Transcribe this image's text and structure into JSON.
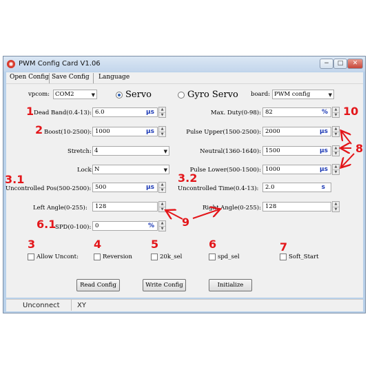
{
  "window": {
    "title": "PWM Config Card V1.06",
    "minimize": "−",
    "maximize": "□",
    "close": "✕",
    "icon": "app-logo-icon"
  },
  "menu": [
    "Open Config",
    "Save Config",
    "Language"
  ],
  "top": {
    "vpcom_label": "vpcom:",
    "vpcom_value": "COM2",
    "mode_servo": "Servo",
    "mode_gyro": "Gyro Servo",
    "mode_selected": "Servo",
    "board_label": "board:",
    "board_value": "PWM config"
  },
  "left": {
    "dead_band": {
      "label": "Dead Band(0.4-13):",
      "value": "6.0",
      "unit": "μs"
    },
    "boost": {
      "label": "Boost(10-2500):",
      "value": "1000",
      "unit": "μs"
    },
    "stretch": {
      "label": "Stretch:",
      "value": "4"
    },
    "lock": {
      "label": "Lock:",
      "value": "N"
    },
    "uncontrolled_pos": {
      "label": "Uncontrolled Pos(500-2500):",
      "value": "500",
      "unit": "μs"
    },
    "left_angle": {
      "label": "Left Angle(0-255):",
      "value": "128"
    },
    "spd": {
      "label": "SPD(0-100):",
      "value": "0",
      "unit": "%"
    }
  },
  "right": {
    "max_duty": {
      "label": "Max. Duty(0-98):",
      "value": "82",
      "unit": "%"
    },
    "pulse_upper": {
      "label": "Pulse Upper(1500-2500):",
      "value": "2000",
      "unit": "μs"
    },
    "neutral": {
      "label": "Neutral(1360-1640):",
      "value": "1500",
      "unit": "μs"
    },
    "pulse_lower": {
      "label": "Pulse Lower(500-1500):",
      "value": "1000",
      "unit": "μs"
    },
    "uncontrolled_time": {
      "label": "Uncontrolled Time(0.4-13):",
      "value": "2.0",
      "unit": "s"
    },
    "right_angle": {
      "label": "Right Angle(0-255):",
      "value": "128"
    }
  },
  "checkboxes": [
    {
      "label": "Allow Uncont:",
      "checked": false
    },
    {
      "label": "Reversion",
      "checked": false
    },
    {
      "label": "20k_sel",
      "checked": false
    },
    {
      "label": "spd_sel",
      "checked": false
    },
    {
      "label": "Soft_Start",
      "checked": false
    }
  ],
  "buttons": {
    "read": "Read Config",
    "write": "Write Config",
    "init": "Initialize"
  },
  "status": {
    "connection": "Unconnect",
    "extra": "XY"
  },
  "annotations": [
    "1",
    "2",
    "3.1",
    "6.1",
    "3",
    "4",
    "5",
    "6",
    "7",
    "10",
    "8",
    "3.2",
    "9"
  ],
  "colors": {
    "annotation": "#e3161a",
    "unit": "#1c39b5",
    "window_border": "#b9d1ea",
    "face": "#f0f0f0"
  },
  "spin_glyphs": {
    "up": "▲",
    "down": "▼"
  },
  "combo_glyph": "▼"
}
